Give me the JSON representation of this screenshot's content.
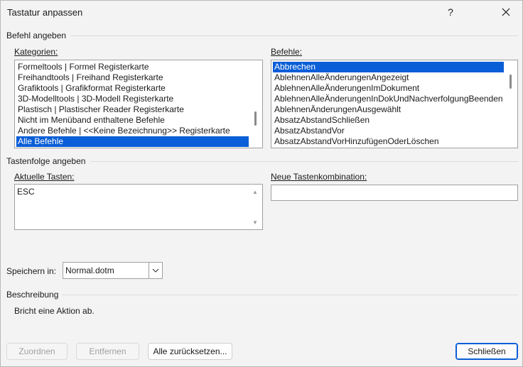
{
  "window": {
    "title": "Tastatur anpassen",
    "help_glyph": "?",
    "close_glyph": "✕"
  },
  "befehl_section": {
    "label": "Befehl angeben",
    "kategorien_label": "Kategorien:",
    "befehle_label": "Befehle:",
    "kategorien": [
      "Formeltools | Formel Registerkarte",
      "Freihandtools | Freihand Registerkarte",
      "Grafiktools | Grafikformat Registerkarte",
      "3D-Modelltools | 3D-Modell Registerkarte",
      "Plastisch | Plastischer Reader Registerkarte",
      "Nicht im Menüband enthaltene Befehle",
      "Andere Befehle | <<Keine Bezeichnung>> Registerkarte",
      "Alle Befehle"
    ],
    "kategorien_selected_index": 7,
    "befehle": [
      "Abbrechen",
      "AblehnenAlleÄnderungenAngezeigt",
      "AblehnenAlleÄnderungenImDokument",
      "AblehnenAlleÄnderungenInDokUndNachverfolgungBeenden",
      "AblehnenÄnderungenAusgewählt",
      "AbsatzAbstandSchließen",
      "AbsatzAbstandVor",
      "AbsatzAbstandVorHinzufügenOderLöschen"
    ],
    "befehle_selected_index": 0
  },
  "tasten_section": {
    "label": "Tastenfolge angeben",
    "aktuelle_label": "Aktuelle Tasten:",
    "aktuelle_tasten": [
      "ESC"
    ],
    "neue_label": "Neue Tastenkombination:",
    "neue_value": ""
  },
  "speichern": {
    "label": "Speichern in:",
    "value": "Normal.dotm"
  },
  "beschreibung": {
    "label": "Beschreibung",
    "text": "Bricht eine Aktion ab."
  },
  "buttons": {
    "zuordnen": "Zuordnen",
    "entfernen": "Entfernen",
    "reset": "Alle zurücksetzen...",
    "schliessen": "Schließen"
  },
  "colors": {
    "selection": "#0a5ed7",
    "background": "#f3f3f3"
  }
}
